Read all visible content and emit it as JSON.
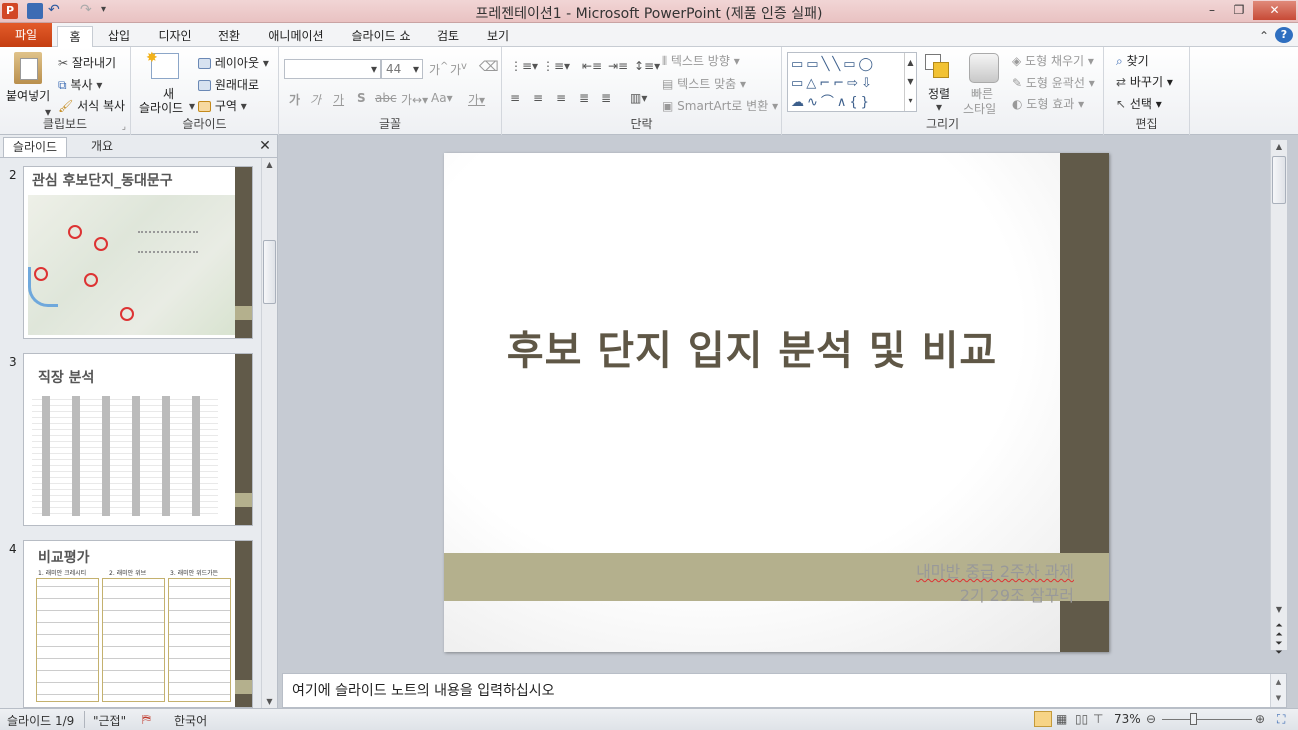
{
  "window": {
    "title": "프레젠테이션1  -  Microsoft PowerPoint (제품 인증 실패)"
  },
  "tabs": [
    "파일",
    "홈",
    "삽입",
    "디자인",
    "전환",
    "애니메이션",
    "슬라이드 쇼",
    "검토",
    "보기"
  ],
  "ribbon": {
    "clipboard": {
      "paste": "붙여넣기",
      "cut": "잘라내기",
      "copy": "복사",
      "format_painter": "서식 복사",
      "label": "클립보드"
    },
    "slides": {
      "new_slide_1": "새",
      "new_slide_2": "슬라이드",
      "layout": "레이아웃",
      "reset": "원래대로",
      "section": "구역",
      "label": "슬라이드"
    },
    "font": {
      "size": "44",
      "label": "글꼴"
    },
    "paragraph": {
      "text_direction": "텍스트 방향",
      "align_text": "텍스트 맞춤",
      "smartart": "SmartArt로 변환",
      "label": "단락"
    },
    "drawing": {
      "arrange": "정렬",
      "quick_styles_1": "빠른",
      "quick_styles_2": "스타일",
      "shape_fill": "도형 채우기",
      "shape_outline": "도형 윤곽선",
      "shape_effects": "도형 효과",
      "label": "그리기"
    },
    "editing": {
      "find": "찾기",
      "replace": "바꾸기",
      "select": "선택",
      "label": "편집"
    }
  },
  "pane": {
    "tab_slides": "슬라이드",
    "tab_outline": "개요"
  },
  "thumbnails": [
    {
      "num": "2",
      "title": "관심 후보단지_동대문구"
    },
    {
      "num": "3",
      "title": "직장 분석"
    },
    {
      "num": "4",
      "title": "비교평가",
      "cols": [
        "1. 래미안 크레시티",
        "2. 래미안 위브",
        "3. 래미안 위드가든"
      ]
    }
  ],
  "slide": {
    "title": "후보 단지 입지 분석 및 비교",
    "subtitle_line1": "내마반 중급 2주차 과제",
    "subtitle_line2": "2기 29조 잠꾸러"
  },
  "notes": {
    "placeholder": "여기에 슬라이드 노트의 내용을 입력하십시오"
  },
  "status": {
    "slide": "슬라이드 1/9",
    "theme": "\"근접\"",
    "language": "한국어",
    "zoom": "73%"
  },
  "colors": {
    "file_tab": "#d34b1c",
    "slide_bar": "#615a49",
    "slide_accent": "#b4b08d",
    "title_text": "#5f5746"
  }
}
